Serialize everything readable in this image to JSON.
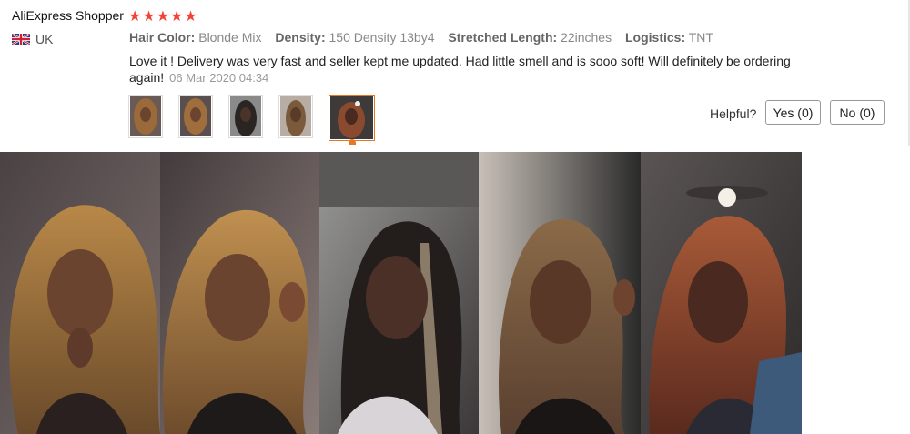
{
  "reviewer": {
    "name": "AliExpress Shopper",
    "stars": "★★★★★",
    "country": "UK",
    "flag_icon": "uk-flag-icon"
  },
  "attributes": [
    {
      "label": "Hair Color:",
      "value": "Blonde Mix"
    },
    {
      "label": "Density:",
      "value": "150 Density 13by4"
    },
    {
      "label": "Stretched Length:",
      "value": "22inches"
    },
    {
      "label": "Logistics:",
      "value": "TNT"
    }
  ],
  "review": {
    "text": "Love it ! Delivery was very fast and seller kept me updated. Had little smell and is sooo soft! Will definitely be ordering again!",
    "date": "06 Mar 2020 04:34"
  },
  "helpful": {
    "label": "Helpful?",
    "yes": "Yes (0)",
    "no": "No (0)"
  },
  "colors": {
    "star": "#f44336",
    "accent": "#e87722"
  },
  "thumbnails_count": 5,
  "selected_thumbnail": 5
}
